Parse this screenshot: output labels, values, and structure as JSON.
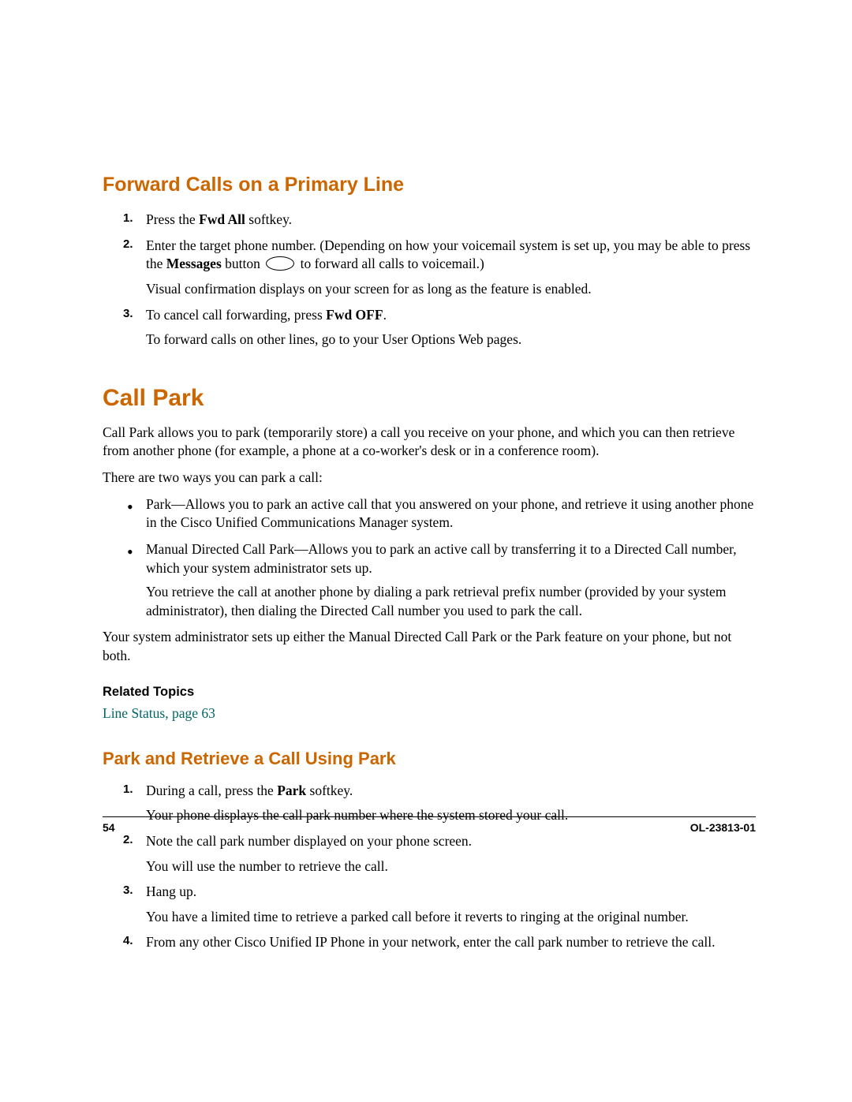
{
  "section1": {
    "heading": "Forward Calls on a Primary Line",
    "steps": [
      {
        "num": "1.",
        "parts": [
          "Press the ",
          "Fwd All",
          " softkey."
        ]
      },
      {
        "num": "2.",
        "parts": [
          "Enter the target phone number. (Depending on how your voicemail system is set up, you may be able to press the ",
          "Messages",
          " button "
        ],
        "after_icon": "to forward all calls to voicemail.)",
        "extra": "Visual confirmation displays on your screen for as long as the feature is enabled."
      },
      {
        "num": "3.",
        "parts": [
          "To cancel call forwarding, press ",
          "Fwd OFF",
          "."
        ],
        "extra": "To forward calls on other lines, go to your User Options Web pages."
      }
    ]
  },
  "section2": {
    "heading": "Call Park",
    "intro1": "Call Park allows you to park (temporarily store) a call you receive on your phone, and which you can then retrieve from another phone (for example, a phone at a co-worker's desk or in a conference room).",
    "intro2": "There are two ways you can park a call:",
    "bullets": [
      {
        "text": "Park—Allows you to park an active call that you answered on your phone, and retrieve it using another phone in the Cisco Unified Communications Manager system."
      },
      {
        "text": "Manual Directed Call Park—Allows you to park an active call by transferring it to a Directed Call number, which your system administrator sets up.",
        "sub": "You retrieve the call at another phone by dialing a park retrieval prefix number (provided by your system administrator), then dialing the Directed Call number you used to park the call."
      }
    ],
    "outro": "Your system administrator sets up either the Manual Directed Call Park or the Park feature on your phone, but not both.",
    "related_heading": "Related Topics",
    "related_link": "Line Status, page 63"
  },
  "section3": {
    "heading": "Park and Retrieve a Call Using Park",
    "steps": [
      {
        "num": "1.",
        "parts": [
          "During a call, press the ",
          "Park",
          " softkey."
        ],
        "extra": "Your phone displays the call park number where the system stored your call."
      },
      {
        "num": "2.",
        "text": "Note the call park number displayed on your phone screen.",
        "extra": "You will use the number to retrieve the call."
      },
      {
        "num": "3.",
        "text": "Hang up.",
        "extra": "You have a limited time to retrieve a parked call before it reverts to ringing at the original number."
      },
      {
        "num": "4.",
        "text": "From any other Cisco Unified IP Phone in your network, enter the call park number to retrieve the call."
      }
    ]
  },
  "footer": {
    "page": "54",
    "docid": "OL-23813-01"
  }
}
